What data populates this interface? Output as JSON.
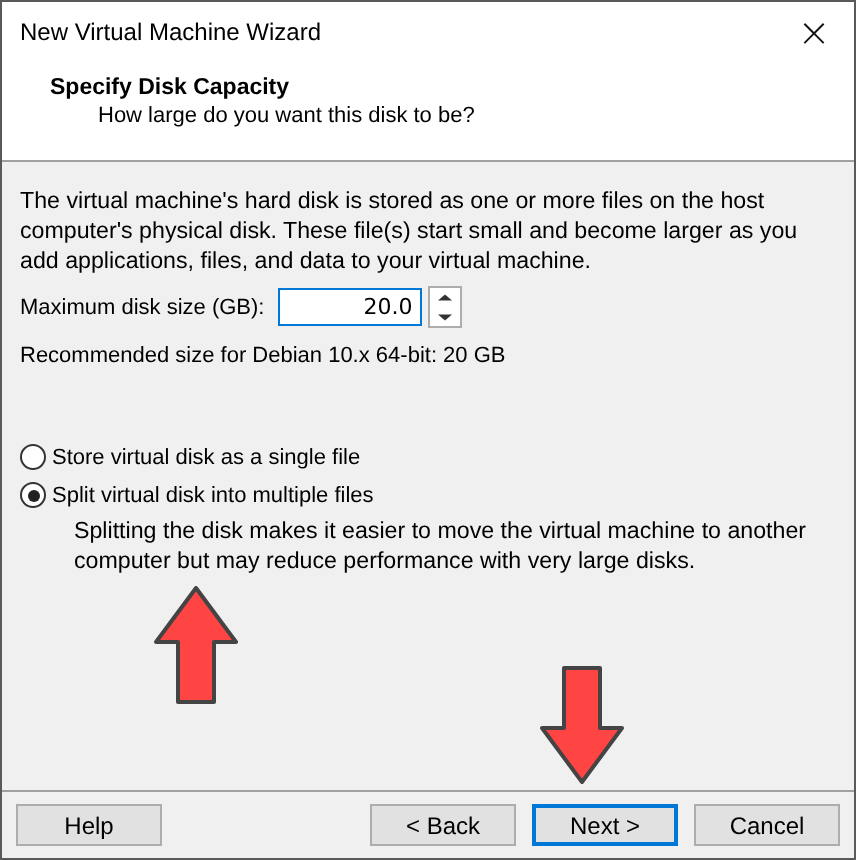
{
  "window": {
    "title": "New Virtual Machine Wizard",
    "close": "×"
  },
  "header": {
    "title": "Specify Disk Capacity",
    "subtitle": "How large do you want this disk to be?"
  },
  "description": "The virtual machine's hard disk is stored as one or more files on the host computer's physical disk. These file(s) start small and become larger as you add applications, files, and data to your virtual machine.",
  "disk_size": {
    "label": "Maximum disk size (GB):",
    "value": "20.0"
  },
  "recommended": "Recommended size for Debian 10.x 64-bit: 20 GB",
  "options": [
    {
      "label": "Store virtual disk as a single file",
      "selected": false
    },
    {
      "label": "Split virtual disk into multiple files",
      "selected": true
    }
  ],
  "option_note": "Splitting the disk makes it easier to move the virtual machine to another computer but may reduce performance with very large disks.",
  "buttons": [
    {
      "label": "Help",
      "focused": false,
      "kind": "help"
    },
    {
      "label": "< Back",
      "focused": false,
      "kind": "nav"
    },
    {
      "label": "Next >",
      "focused": true,
      "kind": "nav"
    },
    {
      "label": "Cancel",
      "focused": false,
      "kind": "nav"
    }
  ]
}
